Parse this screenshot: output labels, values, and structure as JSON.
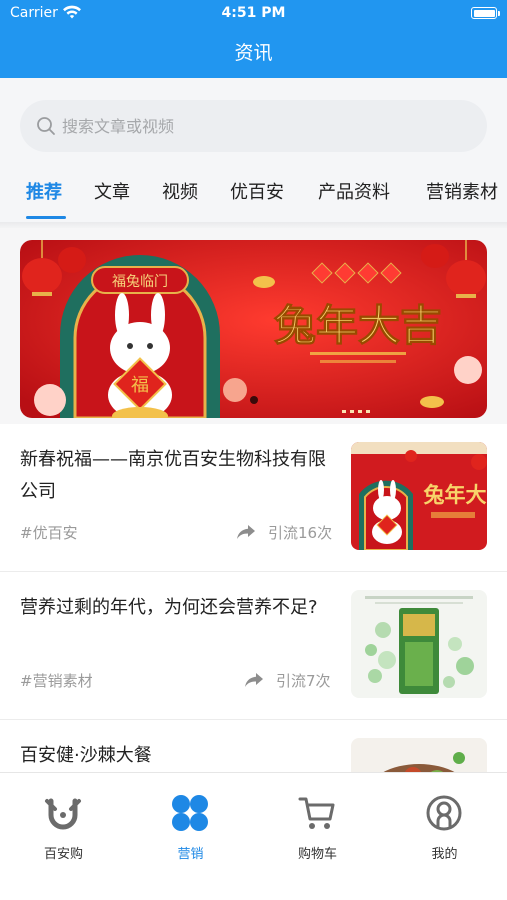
{
  "status": {
    "carrier": "Carrier",
    "time": "4:51 PM"
  },
  "nav": {
    "title": "资讯"
  },
  "search": {
    "placeholder": "搜索文章或视频"
  },
  "tabs": [
    {
      "label": "推荐",
      "active": true
    },
    {
      "label": "文章"
    },
    {
      "label": "视频"
    },
    {
      "label": "优百安"
    },
    {
      "label": "产品资料"
    },
    {
      "label": "营销素材"
    }
  ],
  "banner": {
    "headline": "兔年大吉",
    "plaque": "福兔临门",
    "badge": "福"
  },
  "articles": [
    {
      "title": "新春祝福——南京优百安生物科技有限公司",
      "tag": "#优百安",
      "share": "引流16次",
      "thumb_text": "兔年大"
    },
    {
      "title": "营养过剩的年代，为何还会营养不足?",
      "tag": "#营销素材",
      "share": "引流7次"
    },
    {
      "title": "百安健·沙棘大餐"
    }
  ],
  "tabbar": [
    {
      "label": "百安购",
      "icon": "baiangou-icon"
    },
    {
      "label": "营销",
      "icon": "grid-icon",
      "active": true
    },
    {
      "label": "购物车",
      "icon": "cart-icon"
    },
    {
      "label": "我的",
      "icon": "profile-icon"
    }
  ],
  "colors": {
    "primary": "#2196f0",
    "accent": "#1e88e5",
    "banner_red": "#d4161b"
  }
}
